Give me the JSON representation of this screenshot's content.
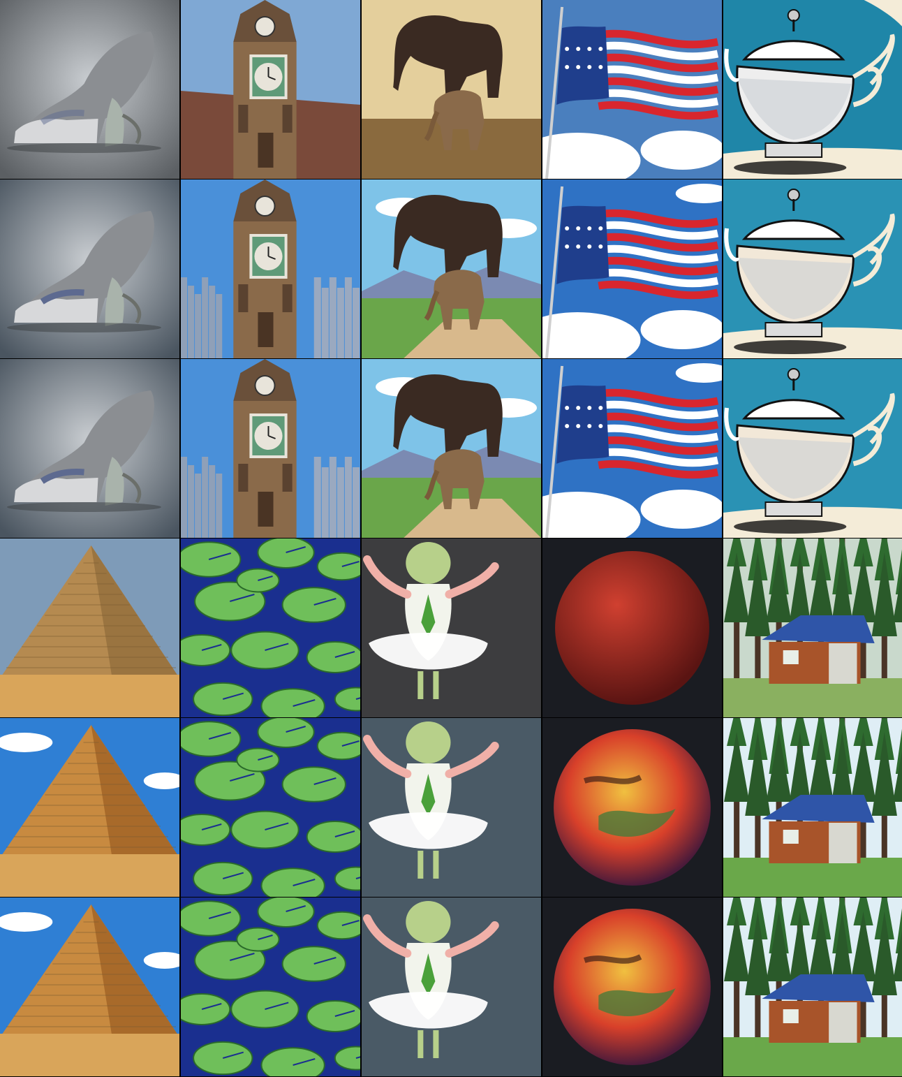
{
  "grid": {
    "columns": 5,
    "rows": 6,
    "row_groups": [
      {
        "rows": 3,
        "subjects": [
          "shoe",
          "clock-tower",
          "elephant-on-elephant",
          "flag",
          "teapot"
        ]
      },
      {
        "rows": 3,
        "subjects": [
          "pyramid",
          "lily-pads",
          "onion-ballerina",
          "red-planet",
          "cabin-in-forest"
        ]
      }
    ],
    "variants_per_group": [
      "original",
      "styled-a",
      "styled-b"
    ]
  },
  "colors": {
    "sky_blue": "#3f7fc4",
    "teal": "#1f86a8",
    "sand": "#d9a55a",
    "pond_blue": "#1a2f8f",
    "lily_green": "#6fbf5a",
    "planet_red": "#b0302a",
    "forest_green": "#2e6b2f",
    "flag_red": "#d8262e",
    "flag_blue": "#1f3e8c"
  }
}
